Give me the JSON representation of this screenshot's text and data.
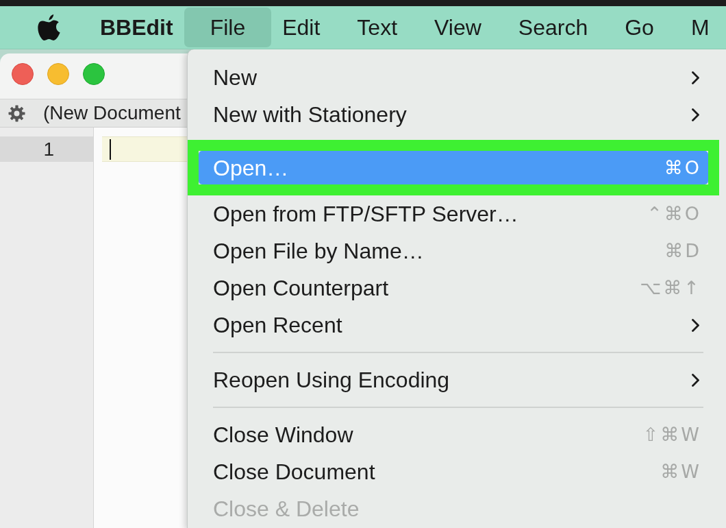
{
  "menubar": {
    "app_name": "BBEdit",
    "menus": [
      {
        "label": "File",
        "selected": true
      },
      {
        "label": "Edit",
        "selected": false
      },
      {
        "label": "Text",
        "selected": false
      },
      {
        "label": "View",
        "selected": false
      },
      {
        "label": "Search",
        "selected": false
      },
      {
        "label": "Go",
        "selected": false
      },
      {
        "label": "M",
        "selected": false
      }
    ]
  },
  "window": {
    "document_title": "(New Document",
    "line_numbers": [
      "1"
    ]
  },
  "file_menu": {
    "items": [
      {
        "kind": "item",
        "label": "New",
        "submenu": true,
        "selected": false,
        "disabled": false,
        "outlined": false
      },
      {
        "kind": "item",
        "label": "New with Stationery",
        "submenu": true,
        "selected": false,
        "disabled": false,
        "outlined": false
      },
      {
        "kind": "item",
        "label": "Open…",
        "shortcut": "⌘O",
        "submenu": false,
        "selected": true,
        "disabled": false,
        "outlined": true
      },
      {
        "kind": "item",
        "label": "Open from FTP/SFTP Server…",
        "shortcut": "⌃⌘O",
        "submenu": false,
        "selected": false,
        "disabled": false,
        "outlined": false
      },
      {
        "kind": "item",
        "label": "Open File by Name…",
        "shortcut": "⌘D",
        "submenu": false,
        "selected": false,
        "disabled": false,
        "outlined": false
      },
      {
        "kind": "item",
        "label": "Open Counterpart",
        "shortcut": "⌥⌘↑",
        "submenu": false,
        "selected": false,
        "disabled": false,
        "outlined": false
      },
      {
        "kind": "item",
        "label": "Open Recent",
        "submenu": true,
        "selected": false,
        "disabled": false,
        "outlined": false
      },
      {
        "kind": "separator"
      },
      {
        "kind": "item",
        "label": "Reopen Using Encoding",
        "submenu": true,
        "selected": false,
        "disabled": false,
        "outlined": false
      },
      {
        "kind": "separator"
      },
      {
        "kind": "item",
        "label": "Close Window",
        "shortcut": "⇧⌘W",
        "submenu": false,
        "selected": false,
        "disabled": false,
        "outlined": false
      },
      {
        "kind": "item",
        "label": "Close Document",
        "shortcut": "⌘W",
        "submenu": false,
        "selected": false,
        "disabled": false,
        "outlined": false
      },
      {
        "kind": "item",
        "label": "Close & Delete",
        "submenu": false,
        "selected": false,
        "disabled": true,
        "outlined": false
      }
    ]
  }
}
